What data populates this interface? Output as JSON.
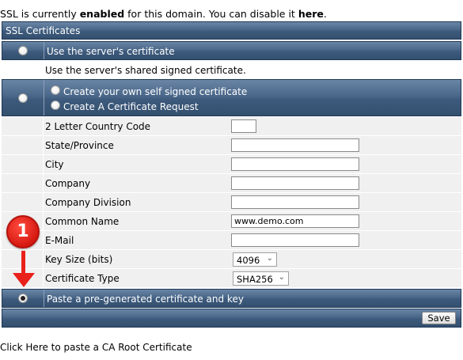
{
  "notice": {
    "prefix": "SSL is currently ",
    "status": "enabled",
    "middle": " for this domain. You can disable it ",
    "link": "here",
    "suffix": "."
  },
  "section_title": "SSL Certificates",
  "option_server": {
    "label": "Use the server's certificate",
    "description": "Use the server's shared signed certificate."
  },
  "option_self": {
    "choice_self_signed": "Create your own self signed certificate",
    "choice_request": "Create A Certificate Request"
  },
  "form": {
    "country_label": "2 Letter Country Code",
    "country_value": "",
    "state_label": "State/Province",
    "state_value": "",
    "city_label": "City",
    "city_value": "",
    "company_label": "Company",
    "company_value": "",
    "division_label": "Company Division",
    "division_value": "",
    "common_name_label": "Common Name",
    "common_name_value": "www.demo.com",
    "email_label": "E-Mail",
    "email_value": "",
    "key_size_label": "Key Size (bits)",
    "key_size_value": "4096",
    "cert_type_label": "Certificate Type",
    "cert_type_value": "SHA256"
  },
  "option_paste": {
    "label": "Paste a pre-generated certificate and key",
    "selected": true
  },
  "save_label": "Save",
  "footer_link": "Click Here to paste a CA Root Certificate",
  "annotation": {
    "step_number": "1",
    "color": "#e8211a"
  }
}
